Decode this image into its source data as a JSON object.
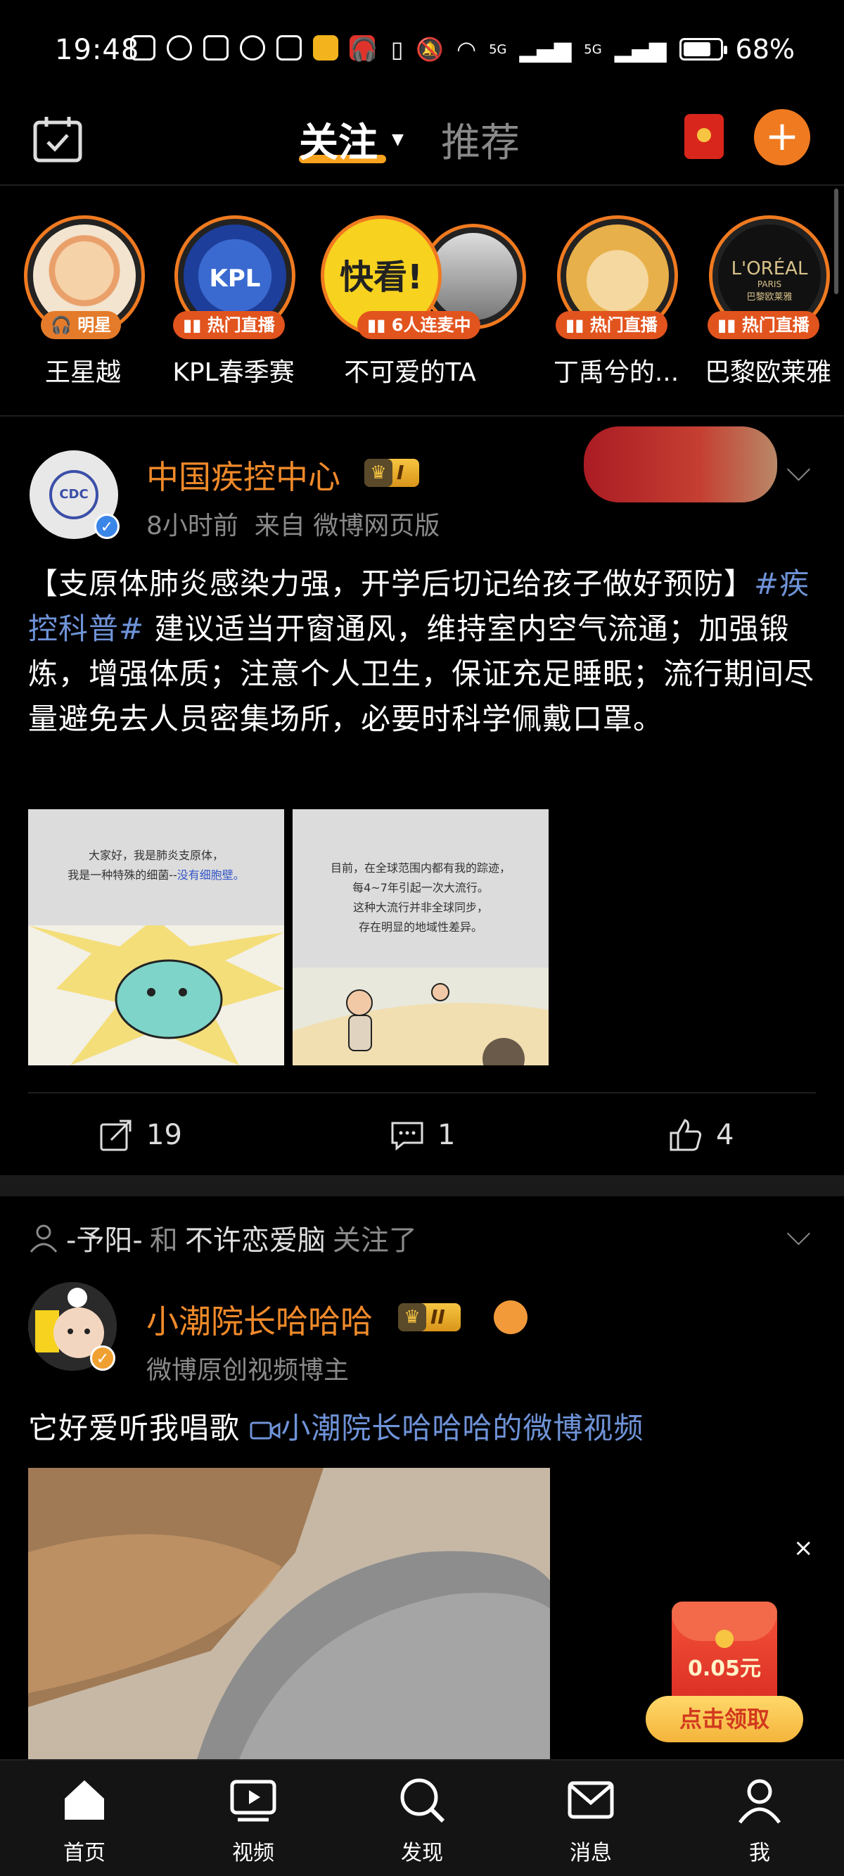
{
  "status_bar": {
    "time": "19:48",
    "battery": "68%",
    "network_labels": [
      "5G",
      "5G"
    ]
  },
  "nav": {
    "tab_follow": "关注",
    "tab_recommend": "推荐"
  },
  "stories": [
    {
      "name": "王星越",
      "badge": "明星"
    },
    {
      "name": "KPL春季赛",
      "badge": "热门直播",
      "avatar_text": "KPL"
    },
    {
      "name": "不可爱的TA",
      "badge": "6人连麦中",
      "avatar_text": "快看!"
    },
    {
      "name": "丁禹兮的...",
      "badge": "热门直播"
    },
    {
      "name": "巴黎欧莱雅",
      "badge": "热门直播",
      "avatar_text": "L'ORÉAL",
      "avatar_sub": "PARIS",
      "avatar_sub2": "巴黎欧莱雅"
    }
  ],
  "post1": {
    "author": "中国疾控中心",
    "avatar_text": "CDC",
    "level": "I",
    "meta_time": "8小时前",
    "meta_source": "来自 微博网页版",
    "title": "【支原体肺炎感染力强，开学后切记给孩子做好预防】",
    "hashtag": "#疾控科普#",
    "body": " 建议适当开窗通风，维持室内空气流通；加强锻炼，增强体质；注意个人卫生，保证充足睡眠；流行期间尽量避免去人员密集场所，必要时科学佩戴口罩。",
    "image1_line1": "大家好，我是肺炎支原体，",
    "image1_line2": "我是一种特殊的细菌--",
    "image1_highlight": "没有细胞壁。",
    "image2_lines": [
      "目前，在全球范围内都有我的踪迹，",
      "每4~7年引起一次大流行。",
      "这种大流行并非全球同步，",
      "存在明显的地域性差异。"
    ],
    "reposts": "19",
    "comments": "1",
    "likes": "4"
  },
  "post2": {
    "follower": "-予阳-",
    "connector": "和",
    "target": "不许恋爱脑",
    "action": "关注了",
    "author": "小潮院长哈哈哈",
    "level": "II",
    "subtitle": "微博原创视频博主",
    "text": "它好爱听我唱歌",
    "video_link": "小潮院长哈哈哈的微博视频"
  },
  "reward": {
    "amount": "0.05元",
    "button": "点击领取",
    "close": "×"
  },
  "tabbar": [
    {
      "label": "首页",
      "icon": "home-icon"
    },
    {
      "label": "视频",
      "icon": "video-icon"
    },
    {
      "label": "发现",
      "icon": "search-icon"
    },
    {
      "label": "消息",
      "icon": "mail-icon"
    },
    {
      "label": "我",
      "icon": "profile-icon"
    }
  ],
  "colors": {
    "accent_orange": "#f07a20",
    "author_orange": "#f08a2a",
    "tab_underline": "#f7a31e",
    "hashtag_blue": "#6f93d8",
    "live_badge": "#e2541e"
  }
}
